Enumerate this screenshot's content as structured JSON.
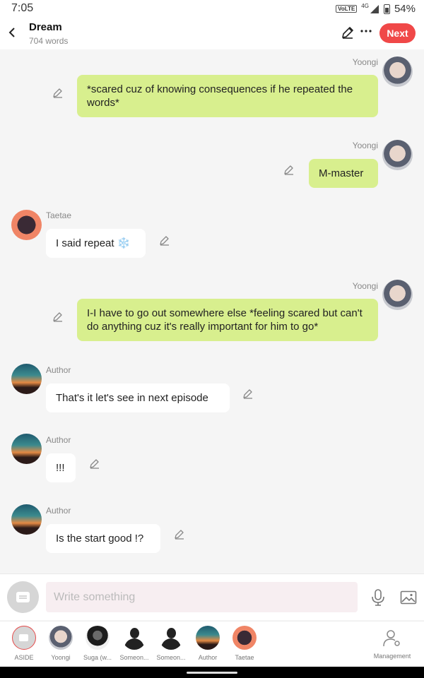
{
  "status": {
    "time": "7:05",
    "network_badge": "VoLTE",
    "network_type": "4G",
    "battery": "54%"
  },
  "header": {
    "title": "Dream",
    "word_count": "704 words",
    "next_label": "Next"
  },
  "messages": [
    {
      "side": "right",
      "sender": "Yoongi",
      "text": "*scared cuz of knowing consequences if he repeated the words*",
      "avatar": "yoongi"
    },
    {
      "side": "right",
      "sender": "Yoongi",
      "text": "M-master",
      "avatar": "yoongi"
    },
    {
      "side": "left",
      "sender": "Taetae",
      "text": "I said repeat ❄️",
      "avatar": "taetae"
    },
    {
      "side": "right",
      "sender": "Yoongi",
      "text": "I-I have to go out somewhere else *feeling scared but can't do anything cuz it's really important for him to go*",
      "avatar": "yoongi"
    },
    {
      "side": "left",
      "sender": "Author",
      "text": "That's it let's see in next episode",
      "avatar": "author"
    },
    {
      "side": "left",
      "sender": "Author",
      "text": "!!!",
      "avatar": "author"
    },
    {
      "side": "left",
      "sender": "Author",
      "text": "Is the start good !?",
      "avatar": "author"
    }
  ],
  "composer": {
    "placeholder": "Write something"
  },
  "characters": [
    {
      "name": "ASIDE",
      "avatar": "aside"
    },
    {
      "name": "Yoongi",
      "avatar": "yoongi"
    },
    {
      "name": "Suga (w...",
      "avatar": "suga"
    },
    {
      "name": "Someon...",
      "avatar": "silhouette"
    },
    {
      "name": "Someon...",
      "avatar": "silhouette"
    },
    {
      "name": "Author",
      "avatar": "author"
    },
    {
      "name": "Taetae",
      "avatar": "taetae"
    }
  ],
  "management_label": "Management",
  "colors": {
    "accent": "#f04848",
    "bubble_right": "#d8ef8e",
    "bubble_left": "#ffffff",
    "background": "#f5f5f5"
  }
}
